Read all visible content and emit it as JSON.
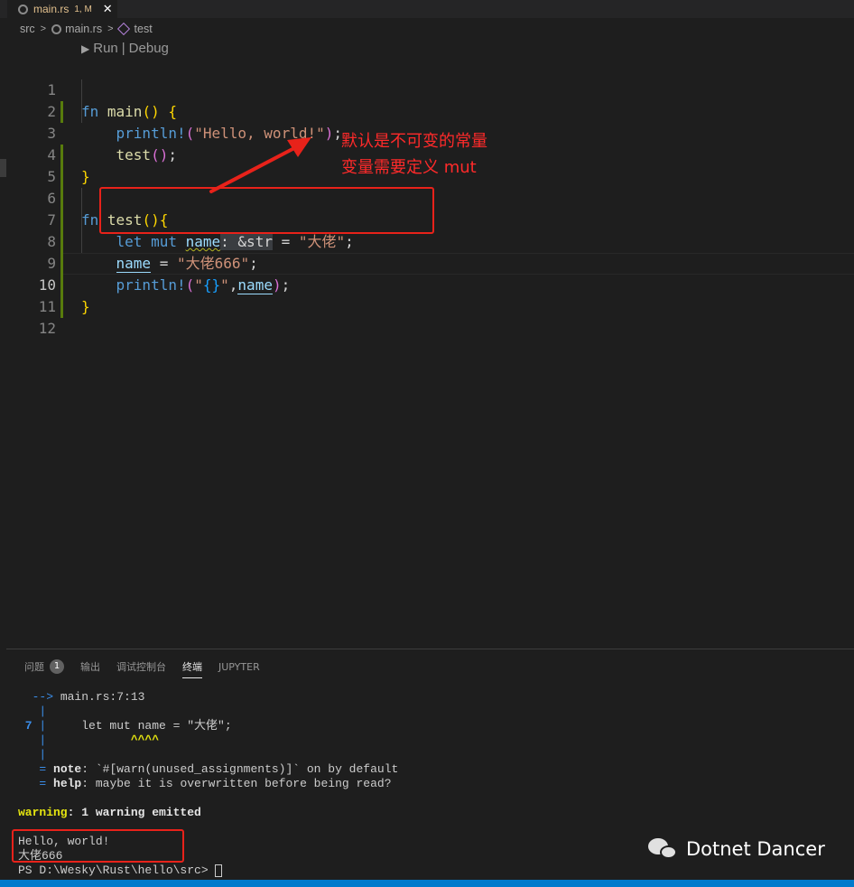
{
  "tab": {
    "filename": "main.rs",
    "status": "1, M",
    "close": "✕"
  },
  "breadcrumb": {
    "src": "src",
    "file": "main.rs",
    "symbol": "test"
  },
  "codelens": {
    "run": "Run",
    "sep": "|",
    "debug": "Debug"
  },
  "editor": {
    "line_numbers": [
      "1",
      "2",
      "3",
      "4",
      "5",
      "6",
      "7",
      "8",
      "9",
      "10",
      "11",
      "12"
    ],
    "active_line": "10"
  },
  "annotation": {
    "line1": "默认是不可变的常量",
    "line2": "变量需要定义 mut",
    "color": "#e8221a"
  },
  "panel": {
    "tabs": [
      {
        "label": "问题",
        "badge": "1"
      },
      {
        "label": "输出"
      },
      {
        "label": "调试控制台"
      },
      {
        "label": "终端"
      },
      {
        "label": "JUPYTER"
      }
    ],
    "active_tab": "终端"
  },
  "terminal": {
    "lines": {
      "arrow": "  -->",
      "location": " main.rs:7:13",
      "pipe": "   |",
      "lineno": " 7",
      "code": "     let mut name = \"大佬\";",
      "carets": "            ^^^^",
      "note_eq": "   = ",
      "note_label": "note",
      "note_text": ": `#[warn(unused_assignments)]` on by default",
      "help_label": "help",
      "help_text": ": maybe it is overwritten before being read?",
      "warning_label": "warning",
      "warning_text": ": 1 warning emitted",
      "hello": "Hello, world!",
      "out2": "大佬666",
      "prompt": "PS D:\\Wesky\\Rust\\hello\\src> "
    }
  },
  "watermark": {
    "text": "Dotnet Dancer",
    "icon": "wechat-icon"
  }
}
